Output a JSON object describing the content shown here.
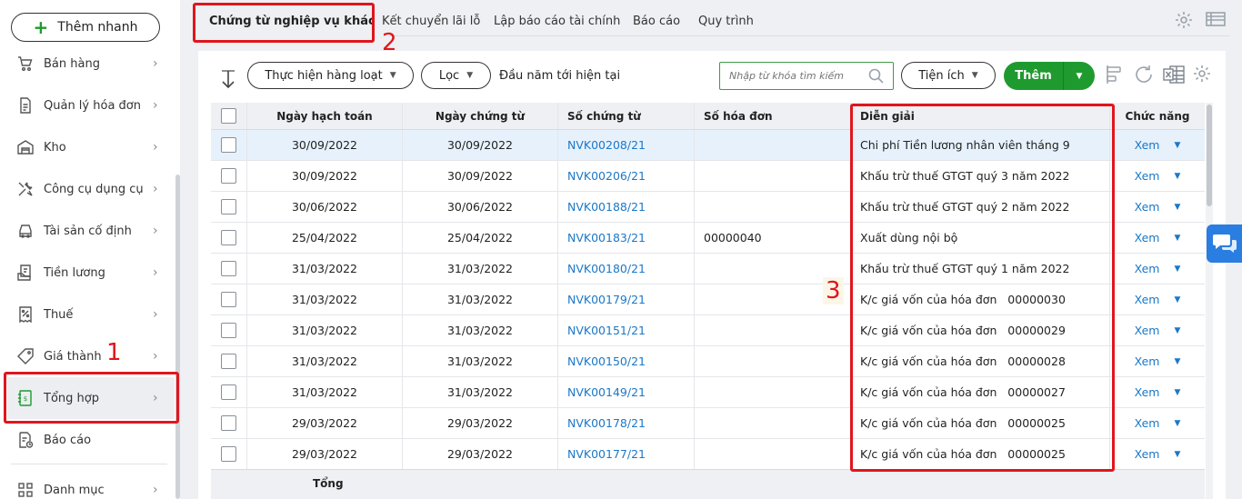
{
  "sidebar": {
    "quick_add": "Thêm nhanh",
    "items": [
      {
        "label": "Bán hàng",
        "icon": "cart-icon"
      },
      {
        "label": "Quản lý hóa đơn",
        "icon": "invoice-icon"
      },
      {
        "label": "Kho",
        "icon": "warehouse-icon"
      },
      {
        "label": "Công cụ dụng cụ",
        "icon": "tools-icon"
      },
      {
        "label": "Tài sản cố định",
        "icon": "car-icon"
      },
      {
        "label": "Tiền lương",
        "icon": "salary-icon"
      },
      {
        "label": "Thuế",
        "icon": "tax-icon"
      },
      {
        "label": "Giá thành",
        "icon": "price-tag-icon"
      },
      {
        "label": "Tổng hợp",
        "icon": "ledger-icon"
      },
      {
        "label": "Báo cáo",
        "icon": "report-icon"
      },
      {
        "label": "Danh mục",
        "icon": "grid-icon"
      }
    ]
  },
  "annotations": {
    "n1": "1",
    "n2": "2",
    "n3": "3"
  },
  "tabs": [
    "Chứng từ nghiệp vụ khác",
    "Kết chuyển lãi lỗ",
    "Lập báo cáo tài chính",
    "Báo cáo",
    "Quy trình"
  ],
  "toolbar": {
    "batch": "Thực hiện hàng loạt",
    "filter": "Lọc",
    "period": "Đầu năm tới hiện tại",
    "search_placeholder": "Nhập từ khóa tìm kiếm",
    "utility": "Tiện ích",
    "add": "Thêm"
  },
  "table": {
    "columns": [
      "Ngày hạch toán",
      "Ngày chứng từ",
      "Số chứng từ",
      "Số hóa đơn",
      "Diễn giải",
      "Chức năng"
    ],
    "rows": [
      {
        "ht": "30/09/2022",
        "ct": "30/09/2022",
        "so": "NVK00208/21",
        "hd": "",
        "dg": "Chi phí Tiền lương nhân viên tháng 9",
        "cn": "Xem"
      },
      {
        "ht": "30/09/2022",
        "ct": "30/09/2022",
        "so": "NVK00206/21",
        "hd": "",
        "dg": "Khấu trừ thuế GTGT quý 3 năm 2022",
        "cn": "Xem"
      },
      {
        "ht": "30/06/2022",
        "ct": "30/06/2022",
        "so": "NVK00188/21",
        "hd": "",
        "dg": "Khấu trừ thuế GTGT quý 2 năm 2022",
        "cn": "Xem"
      },
      {
        "ht": "25/04/2022",
        "ct": "25/04/2022",
        "so": "NVK00183/21",
        "hd": "00000040",
        "dg": "Xuất dùng nội bộ",
        "cn": "Xem"
      },
      {
        "ht": "31/03/2022",
        "ct": "31/03/2022",
        "so": "NVK00180/21",
        "hd": "",
        "dg": "Khấu trừ thuế GTGT quý 1 năm 2022",
        "cn": "Xem"
      },
      {
        "ht": "31/03/2022",
        "ct": "31/03/2022",
        "so": "NVK00179/21",
        "hd": "",
        "dg": "K/c giá vốn của hóa đơn   00000030",
        "cn": "Xem"
      },
      {
        "ht": "31/03/2022",
        "ct": "31/03/2022",
        "so": "NVK00151/21",
        "hd": "",
        "dg": "K/c giá vốn của hóa đơn   00000029",
        "cn": "Xem"
      },
      {
        "ht": "31/03/2022",
        "ct": "31/03/2022",
        "so": "NVK00150/21",
        "hd": "",
        "dg": "K/c giá vốn của hóa đơn   00000028",
        "cn": "Xem"
      },
      {
        "ht": "31/03/2022",
        "ct": "31/03/2022",
        "so": "NVK00149/21",
        "hd": "",
        "dg": "K/c giá vốn của hóa đơn   00000027",
        "cn": "Xem"
      },
      {
        "ht": "29/03/2022",
        "ct": "29/03/2022",
        "so": "NVK00178/21",
        "hd": "",
        "dg": "K/c giá vốn của hóa đơn   00000025",
        "cn": "Xem"
      },
      {
        "ht": "29/03/2022",
        "ct": "29/03/2022",
        "so": "NVK00177/21",
        "hd": "",
        "dg": "K/c giá vốn của hóa đơn   00000025",
        "cn": "Xem"
      }
    ],
    "total_label": "Tổng"
  },
  "colors": {
    "brand_green": "#1f9a2f",
    "link_blue": "#1b78c8",
    "highlight_red": "#e0161d"
  }
}
